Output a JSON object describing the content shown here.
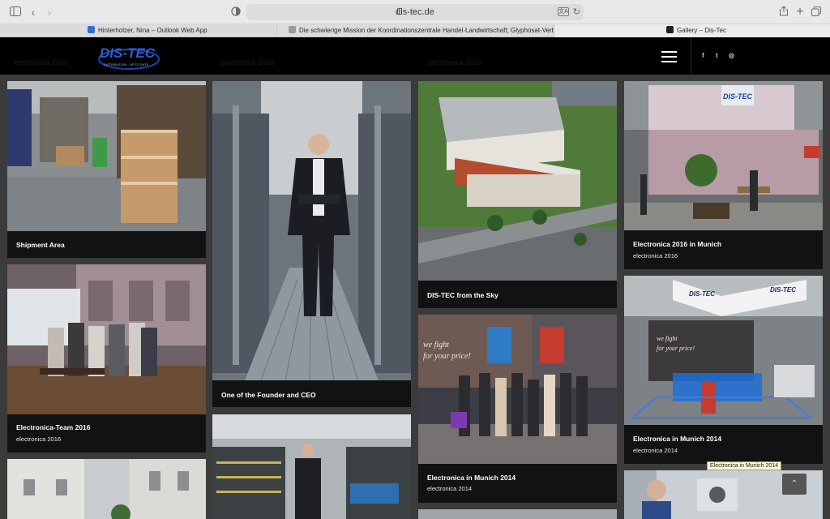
{
  "browser": {
    "url": "dis-tec.de",
    "translate_label": "文A",
    "tabs": [
      {
        "title": "Hinterholzer, Nina – Outlook Web App",
        "favicon_color": "#2f6fd6"
      },
      {
        "title": "Die schwierige Mission der Koordinationszentrale Handel-Landwirtschaft; Glyphosat-Verbote und Inse...",
        "favicon_color": "#9a9a9a"
      },
      {
        "title": "Gallery – Dis-Tec",
        "favicon_color": "#222222"
      }
    ]
  },
  "site": {
    "logo_text": "DIS-TEC",
    "logo_tagline": "DISTRIBUTION · UP TO DATE",
    "ghost_labels": [
      "electronica 2016",
      "electronica 2018",
      "electronica 2016"
    ],
    "social": [
      "f",
      "t",
      "◎"
    ]
  },
  "gallery": [
    {
      "caption": "Shipment Area",
      "sub": ""
    },
    {
      "caption": "Electronica-Team 2016",
      "sub": "electronica 2016"
    },
    {
      "caption": "One of the Founder and CEO",
      "sub": ""
    },
    {
      "caption": "DIS-TEC from the Sky",
      "sub": ""
    },
    {
      "caption": "Electronica in Munich 2014",
      "sub": "electronica 2014"
    },
    {
      "caption": "Electronica 2016 in Munich",
      "sub": "electronica 2016"
    },
    {
      "caption": "Electronica in Munich 2014",
      "sub": "electronica 2014"
    }
  ],
  "tooltip": "Electronica in Munich 2014",
  "colors": {
    "brand_blue": "#1c3fa8",
    "card_bg": "#121212",
    "page_bg": "#3b3b3b"
  }
}
